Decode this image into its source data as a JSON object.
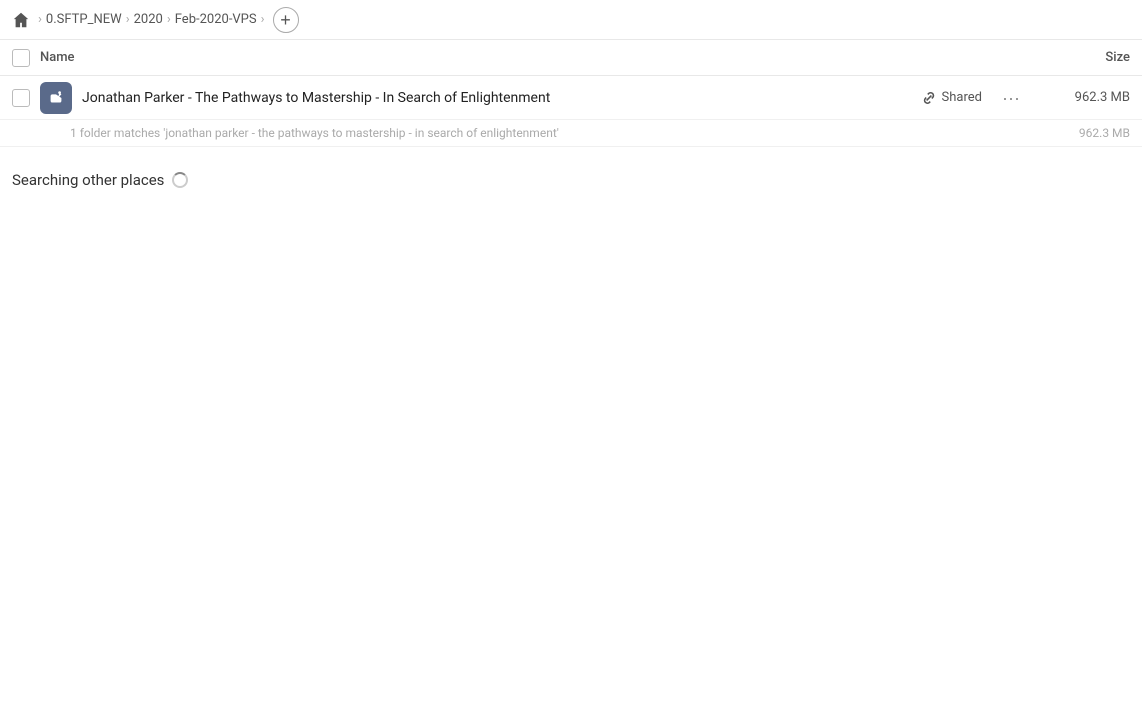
{
  "toolbar": {
    "home_icon": "home",
    "breadcrumbs": [
      {
        "label": "0.SFTP_NEW"
      },
      {
        "label": "2020"
      },
      {
        "label": "Feb-2020-VPS"
      }
    ],
    "add_button_label": "+"
  },
  "columns": {
    "name_label": "Name",
    "size_label": "Size"
  },
  "file_row": {
    "name": "Jonathan Parker - The Pathways to Mastership - In Search of Enlightenment",
    "shared_label": "Shared",
    "size": "962.3 MB"
  },
  "result_summary": {
    "text": "1 folder matches 'jonathan parker - the pathways to mastership - in search of enlightenment'",
    "size": "962.3 MB"
  },
  "searching_section": {
    "label": "Searching other places"
  }
}
